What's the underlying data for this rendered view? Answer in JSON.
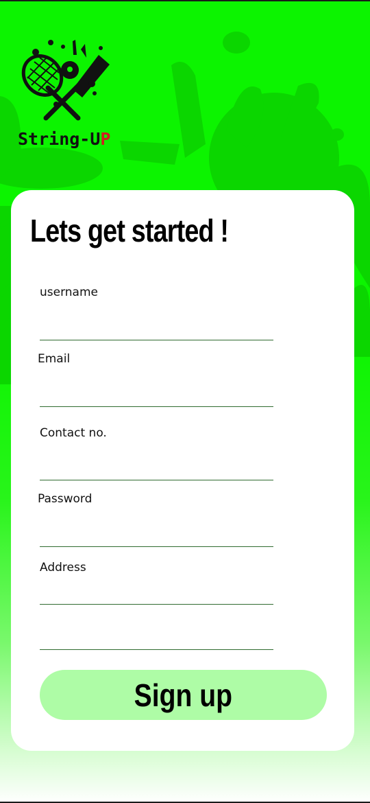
{
  "brand": {
    "logo_text_main": "String-U",
    "logo_text_accent": "P",
    "logo_icon": "tennis-racket-cricket-bat-ball-icon"
  },
  "colors": {
    "background": "#0cf400",
    "card": "#ffffff",
    "button": "#aefca6",
    "field_line": "#2f6b2f"
  },
  "form": {
    "title": "Lets get started !",
    "fields": [
      {
        "label": "username",
        "value": ""
      },
      {
        "label": "Email",
        "value": ""
      },
      {
        "label": "Contact no.",
        "value": ""
      },
      {
        "label": "Password",
        "value": ""
      },
      {
        "label": "Address",
        "value": ""
      }
    ],
    "submit_label": "Sign up"
  }
}
